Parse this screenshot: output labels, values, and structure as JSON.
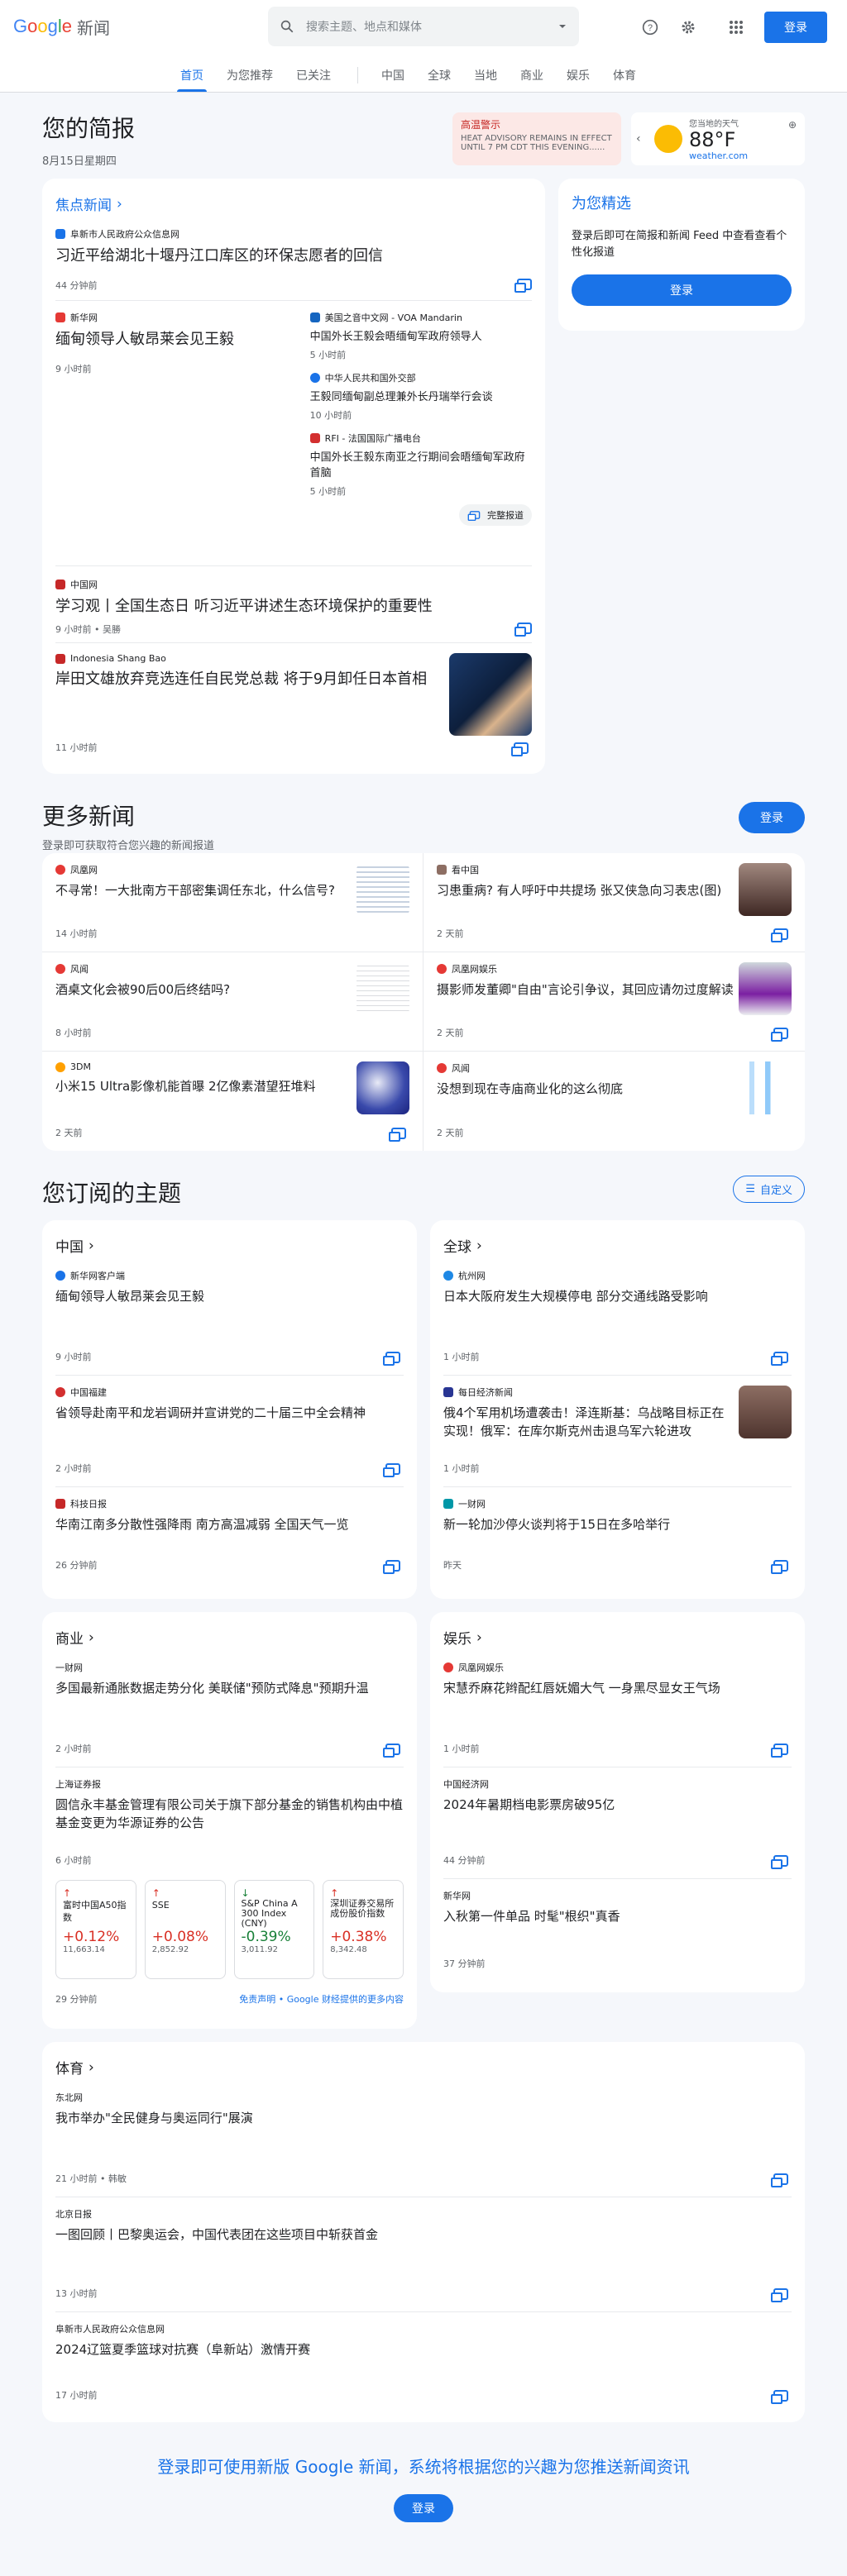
{
  "header": {
    "logo_parts": [
      "G",
      "o",
      "o",
      "g",
      "l",
      "e"
    ],
    "logo_suffix": "新闻",
    "search_placeholder": "搜索主题、地点和媒体",
    "signin": "登录"
  },
  "nav": {
    "items": [
      "首页",
      "为您推荐",
      "已关注",
      "中国",
      "全球",
      "当地",
      "商业",
      "娱乐",
      "体育"
    ]
  },
  "brief": {
    "title": "您的简报",
    "date": "8月15日星期四",
    "alert": {
      "title": "高温警示",
      "text": "HEAT ADVISORY REMAINS IN EFFECT UNTIL 7 PM CDT THIS EVENING......"
    },
    "weather": {
      "label": "您当地的天气",
      "temp": "88°F",
      "source": "weather.com"
    }
  },
  "top_stories": {
    "heading": "焦点新闻",
    "s1": {
      "source": "阜新市人民政府公众信息网",
      "title": "习近平给湖北十堰丹江口库区的环保志愿者的回信",
      "time": "44 分钟前"
    },
    "s2": {
      "source": "新华网",
      "title": "缅甸领导人敏昂莱会见王毅",
      "time": "9 小时前",
      "related": [
        {
          "source": "美国之音中文网 - VOA Mandarin",
          "title": "中国外长王毅会晤缅甸军政府领导人",
          "time": "5 小时前"
        },
        {
          "source": "中华人民共和国外交部",
          "title": "王毅同缅甸副总理兼外长丹瑞举行会谈",
          "time": "10 小时前"
        },
        {
          "source": "RFI - 法国国际广播电台",
          "title": "中国外长王毅东南亚之行期间会晤缅甸军政府首脑",
          "time": "5 小时前"
        }
      ],
      "full": "完整报道"
    },
    "s3": {
      "source": "中国网",
      "title": "学习观丨全国生态日 听习近平讲述生态环境保护的重要性",
      "time": "9 小时前 • 吴勝"
    },
    "s4": {
      "source": "Indonesia Shang Bao",
      "title": "岸田文雄放弃竞选连任自民党总裁 将于9月卸任日本首相",
      "time": "11 小时前"
    }
  },
  "picks": {
    "title": "为您精选",
    "text": "登录后即可在简报和新闻 Feed 中查看查看个性化报道",
    "btn": "登录"
  },
  "more": {
    "title": "更多新闻",
    "sub": "登录即可获取符合您兴趣的新闻报道",
    "btn": "登录",
    "items": [
      {
        "source": "凤凰网",
        "title": "不寻常！一大批南方干部密集调任东北，什么信号?",
        "time": "14 小时前"
      },
      {
        "source": "看中国",
        "title": "习患重病? 有人呼吁中共提场 张又侠急向习表忠(图)",
        "time": "2 天前"
      },
      {
        "source": "风闻",
        "title": "酒桌文化会被90后00后终结吗?",
        "time": "8 小时前"
      },
      {
        "source": "凤凰网娱乐",
        "title": "摄影师发董卿\"自由\"言论引争议，其回应请勿过度解读",
        "time": "2 天前"
      },
      {
        "source": "3DM",
        "title": "小米15 Ultra影像机能首曝 2亿像素潜望狂堆料",
        "time": "2 天前"
      },
      {
        "source": "风闻",
        "title": "没想到现在寺庙商业化的这么彻底",
        "time": "2 天前"
      }
    ]
  },
  "subs": {
    "title": "您订阅的主题",
    "customize": "自定义",
    "china": {
      "title": "中国",
      "items": [
        {
          "source": "新华网客户端",
          "title": "缅甸领导人敏昂莱会见王毅",
          "time": "9 小时前"
        },
        {
          "source": "中国福建",
          "title": "省领导赴南平和龙岩调研并宣讲党的二十届三中全会精神",
          "time": "2 小时前"
        },
        {
          "source": "科技日报",
          "title": "华南江南多分散性强降雨 南方高温减弱 全国天气一览",
          "time": "26 分钟前"
        }
      ]
    },
    "world": {
      "title": "全球",
      "items": [
        {
          "source": "杭州网",
          "title": "日本大阪府发生大规模停电 部分交通线路受影响",
          "time": "1 小时前"
        },
        {
          "source": "每日经济新闻",
          "title": "俄4个军用机场遭袭击！泽连斯基：乌战略目标正在实现！俄军：在库尔斯克州击退乌军六轮进攻",
          "time": "1 小时前"
        },
        {
          "source": "一财网",
          "title": "新一轮加沙停火谈判将于15日在多哈举行",
          "time": "昨天"
        }
      ]
    },
    "business": {
      "title": "商业",
      "items": [
        {
          "source": "一财网",
          "title": "多国最新通胀数据走势分化 美联储\"预防式降息\"预期升温",
          "time": "2 小时前"
        },
        {
          "source": "上海证券报",
          "title": "圆信永丰基金管理有限公司关于旗下部分基金的销售机构由中植基金变更为华源证券的公告",
          "time": "6 小时前"
        }
      ],
      "stocks": [
        {
          "name": "富时中国A50指数",
          "change": "+0.12%",
          "price": "11,663.14",
          "dir": "up"
        },
        {
          "name": "SSE",
          "change": "+0.08%",
          "price": "2,852.92",
          "dir": "up"
        },
        {
          "name": "S&P China A 300 Index (CNY)",
          "change": "-0.39%",
          "price": "3,011.92",
          "dir": "down"
        },
        {
          "name": "深圳证券交易所成份股价指数",
          "change": "+0.38%",
          "price": "8,342.48",
          "dir": "up"
        }
      ],
      "stocks_time": "29 分钟前",
      "disclaimer": "免责声明 • Google 财经提供的更多内容"
    },
    "ent": {
      "title": "娱乐",
      "items": [
        {
          "source": "凤凰网娱乐",
          "title": "宋慧乔麻花辫配红唇妩媚大气 一身黑尽显女王气场",
          "time": "1 小时前"
        },
        {
          "source": "中国经济网",
          "title": "2024年暑期档电影票房破95亿",
          "time": "44 分钟前"
        },
        {
          "source": "新华网",
          "title": "入秋第一件单品 时髦\"根织\"真香",
          "time": "37 分钟前"
        }
      ]
    },
    "sports": {
      "title": "体育",
      "items": [
        {
          "source": "东北网",
          "title": "我市举办\"全民健身与奥运同行\"展演",
          "time": "21 小时前 • 韩敏"
        },
        {
          "source": "北京日报",
          "title": "一图回顾丨巴黎奥运会，中国代表团在这些项目中斩获首金",
          "time": "13 小时前"
        },
        {
          "source": "阜新市人民政府公众信息网",
          "title": "2024辽篮夏季篮球对抗赛（阜新站）激情开赛",
          "time": "17 小时前"
        }
      ]
    }
  },
  "footer": {
    "text": "登录即可使用新版 Google 新闻，系统将根据您的兴趣为您推送新闻资讯",
    "btn": "登录"
  }
}
